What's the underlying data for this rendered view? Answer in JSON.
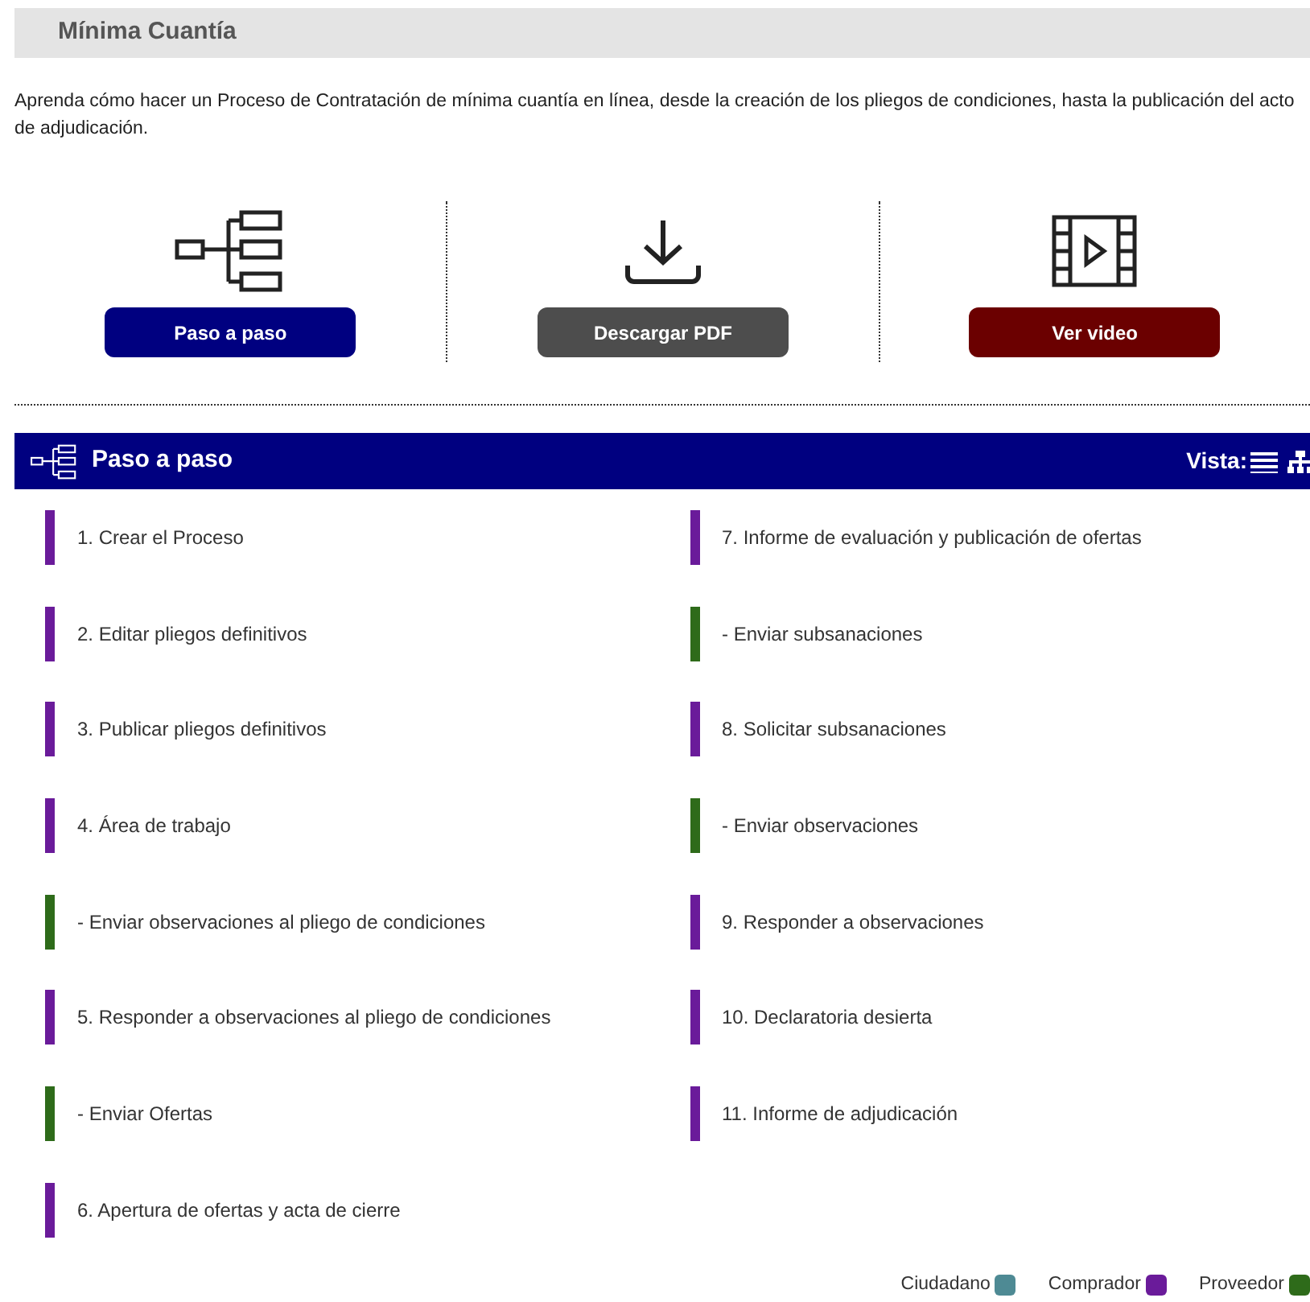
{
  "title": "Mínima Cuantía",
  "intro": "Aprenda cómo hacer un Proceso de Contratación de mínima cuantía en línea, desde la creación de los pliegos de condiciones, hasta la publicación del acto de adjudicación.",
  "actions": [
    {
      "kind": "steps",
      "label": "Paso a paso",
      "color": "#000080"
    },
    {
      "kind": "download",
      "label": "Descargar PDF",
      "color": "#4d4d4d"
    },
    {
      "kind": "video",
      "label": "Ver video",
      "color": "#6b0000"
    }
  ],
  "panel": {
    "title": "Paso a paso",
    "view_label": "Vista:"
  },
  "columns": [
    [
      {
        "label": "1. Crear el Proceso",
        "color": "#6a1b9a"
      },
      {
        "label": "2. Editar pliegos definitivos",
        "color": "#6a1b9a"
      },
      {
        "label": "3. Publicar pliegos definitivos",
        "color": "#6a1b9a"
      },
      {
        "label": "4. Área de trabajo",
        "color": "#6a1b9a"
      },
      {
        "label": "- Enviar observaciones al pliego de condiciones",
        "color": "#2e6b1a"
      },
      {
        "label": "5. Responder a observaciones al pliego de condiciones",
        "color": "#6a1b9a"
      },
      {
        "label": "- Enviar Ofertas",
        "color": "#2e6b1a"
      },
      {
        "label": "6. Apertura de ofertas y acta de cierre",
        "color": "#6a1b9a"
      }
    ],
    [
      {
        "label": "7. Informe de evaluación y publicación de ofertas",
        "color": "#6a1b9a"
      },
      {
        "label": "- Enviar subsanaciones",
        "color": "#2e6b1a"
      },
      {
        "label": "8. Solicitar subsanaciones",
        "color": "#6a1b9a"
      },
      {
        "label": "- Enviar observaciones",
        "color": "#2e6b1a"
      },
      {
        "label": "9. Responder a observaciones",
        "color": "#6a1b9a"
      },
      {
        "label": "10. Declaratoria desierta",
        "color": "#6a1b9a"
      },
      {
        "label": "11. Informe de adjudicación",
        "color": "#6a1b9a"
      }
    ]
  ],
  "legend": [
    {
      "label": "Ciudadano",
      "color": "#4e8a94"
    },
    {
      "label": "Comprador",
      "color": "#6a1b9a"
    },
    {
      "label": "Proveedor",
      "color": "#2e6b1a"
    }
  ]
}
